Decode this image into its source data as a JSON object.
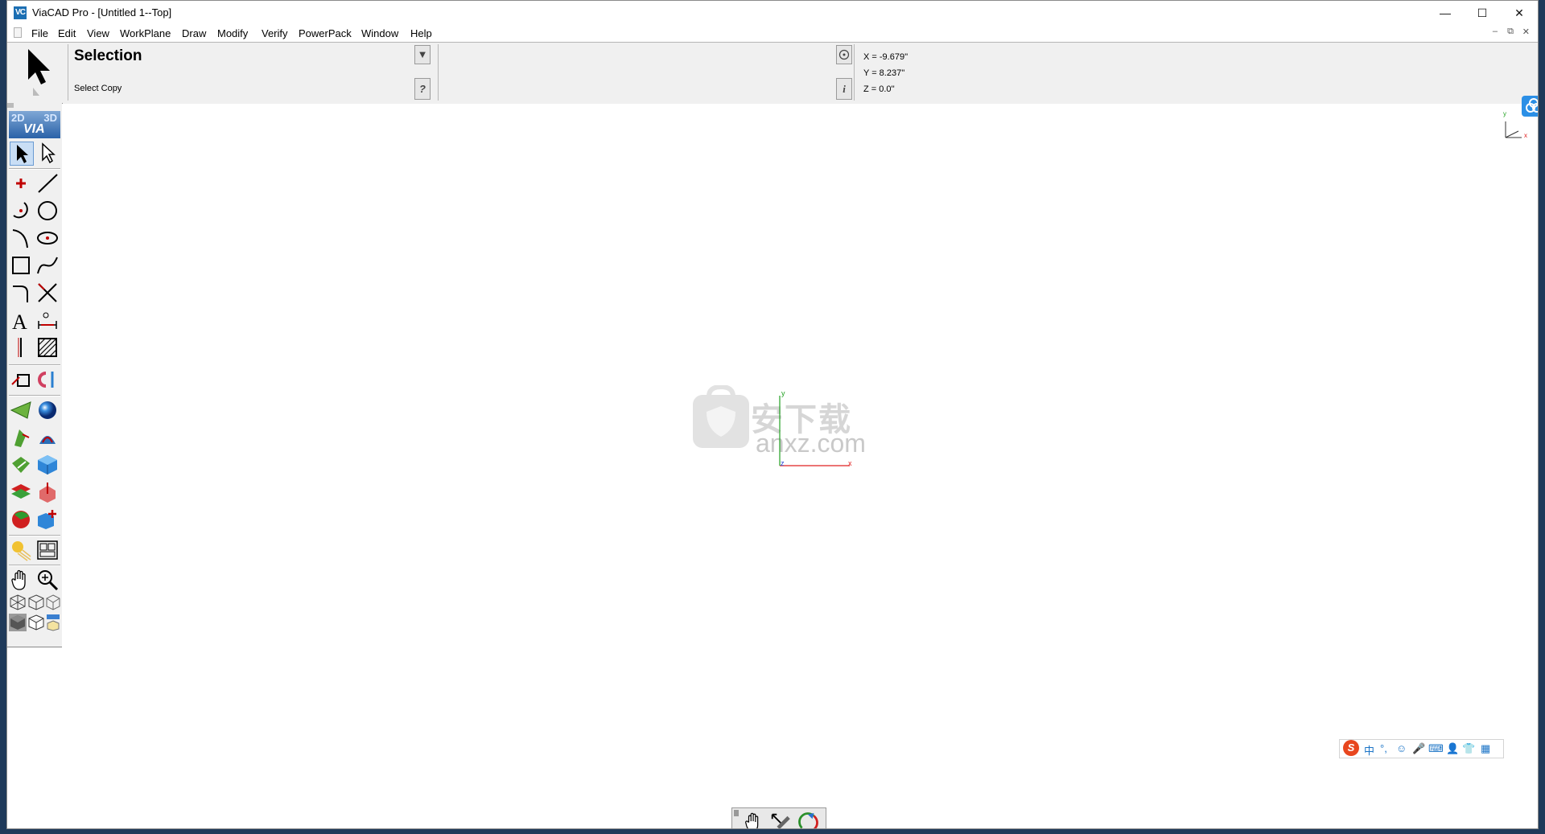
{
  "window": {
    "app_icon": "VC",
    "title": "ViaCAD Pro - [Untitled 1--Top]",
    "controls": {
      "minimize": "—",
      "maximize": "☐",
      "close": "✕"
    }
  },
  "menu": {
    "items": [
      "File",
      "Edit",
      "View",
      "WorkPlane",
      "Draw",
      "Modify",
      "Verify",
      "PowerPack",
      "Window",
      "Help"
    ],
    "mdi_controls": [
      "–",
      "⧉",
      "✕"
    ]
  },
  "property_bar": {
    "mode_title": "Selection",
    "mode_subtitle": "Select Copy",
    "filter_button": "▼",
    "help_button": "?",
    "target_button": "target-icon",
    "info_button": "i",
    "coords": {
      "x": "X = -9.679''",
      "y": "Y = 8.237''",
      "z": "Z = 0.0''"
    }
  },
  "toolbox": {
    "header": {
      "left": "2D",
      "right": "3D",
      "brand": "VIA"
    }
  },
  "canvas": {
    "axis_x": "x",
    "axis_y": "y",
    "axis_z": "z",
    "triad_x": "x",
    "triad_y": "y",
    "watermark": "anxz.com",
    "watermark_cn": "安下载"
  },
  "ime": {
    "items": [
      "S",
      "中",
      "°,",
      "☺",
      "🎤",
      "⌨",
      "👤",
      "👕",
      "▦"
    ]
  },
  "colors": {
    "accent_blue": "#2b8fe6",
    "axis_x": "#e02020",
    "axis_y": "#20a020",
    "axis_z": "#2040d0"
  }
}
